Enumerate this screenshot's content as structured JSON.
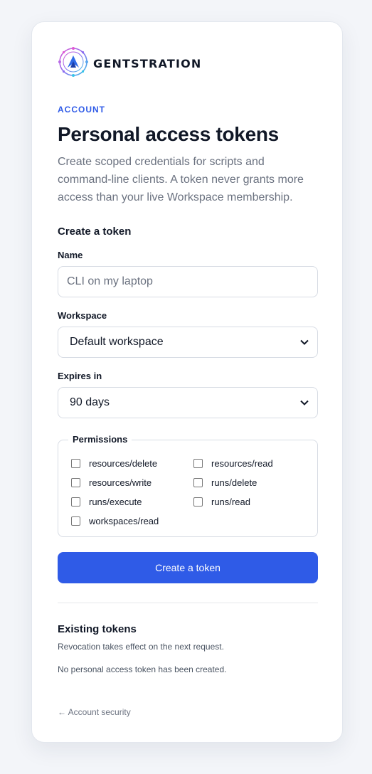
{
  "brand": {
    "name": "GENTSTRATION"
  },
  "header": {
    "eyebrow": "ACCOUNT",
    "title": "Personal access tokens",
    "description": "Create scoped credentials for scripts and command-line clients. A token never grants more access than your live Workspace membership."
  },
  "create": {
    "heading": "Create a token",
    "name_label": "Name",
    "name_placeholder": "CLI on my laptop",
    "workspace_label": "Workspace",
    "workspace_value": "Default workspace",
    "expires_label": "Expires in",
    "expires_value": "90 days",
    "permissions_legend": "Permissions",
    "permissions": [
      "resources/delete",
      "resources/read",
      "resources/write",
      "runs/delete",
      "runs/execute",
      "runs/read",
      "workspaces/read"
    ],
    "submit_label": "Create a token"
  },
  "existing": {
    "heading": "Existing tokens",
    "note": "Revocation takes effect on the next request.",
    "empty": "No personal access token has been created."
  },
  "footer": {
    "back_link": "← Account security"
  },
  "colors": {
    "accent": "#2f5be7",
    "muted": "#6b7280",
    "border": "#d7dce4"
  },
  "icons": {
    "logo": "gentstration-logo-icon",
    "select": "chevron-down-icon"
  }
}
